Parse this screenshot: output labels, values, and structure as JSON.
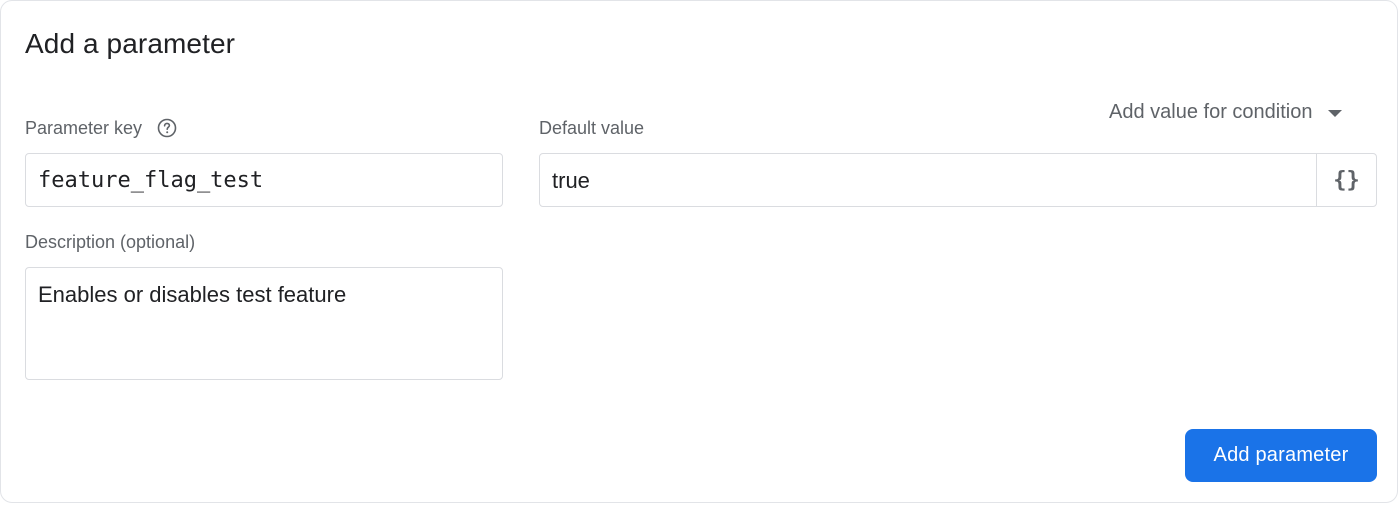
{
  "dialog": {
    "title": "Add a parameter"
  },
  "parameter_key": {
    "label": "Parameter key",
    "help_icon": "help-circle-icon",
    "value": "feature_flag_test"
  },
  "default_value": {
    "label": "Default value",
    "value": "true",
    "json_button_label": "{}"
  },
  "condition": {
    "label": "Add value for condition",
    "icon": "arrow-drop-down-icon"
  },
  "description": {
    "label": "Description (optional)",
    "value": "Enables or disables test feature"
  },
  "actions": {
    "submit_label": "Add parameter"
  },
  "colors": {
    "primary": "#1a73e8",
    "border": "#dadce0",
    "label_text": "#5f6368",
    "text": "#202124"
  }
}
